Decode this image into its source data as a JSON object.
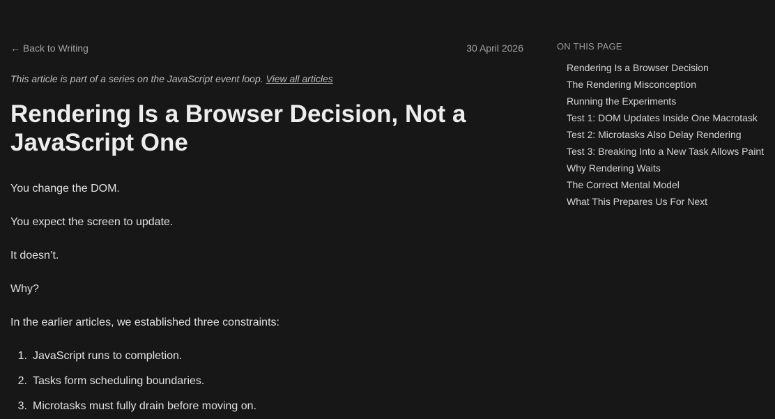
{
  "header": {
    "back_link": "← Back to Writing",
    "date": "30 April 2026"
  },
  "series_note": {
    "text": "This article is part of a series on the JavaScript event loop.",
    "link": "View all articles"
  },
  "article": {
    "title": "Rendering Is a Browser Decision, Not a JavaScript One",
    "paragraphs": [
      "You change the DOM.",
      "You expect the screen to update.",
      "It doesn’t.",
      "Why?",
      "In the earlier articles, we established three constraints:"
    ],
    "list": [
      {
        "num": "1.",
        "text": "JavaScript runs to completion."
      },
      {
        "num": "2.",
        "text": "Tasks form scheduling boundaries."
      },
      {
        "num": "3.",
        "text": "Microtasks must fully drain before moving on."
      }
    ]
  },
  "toc": {
    "heading": "ON THIS PAGE",
    "items": [
      "Rendering Is a Browser Decision",
      "The Rendering Misconception",
      "Running the Experiments",
      "Test 1: DOM Updates Inside One Macrotask",
      "Test 2: Microtasks Also Delay Rendering",
      "Test 3: Breaking Into a New Task Allows Paint",
      "Why Rendering Waits",
      "The Correct Mental Model",
      "What This Prepares Us For Next"
    ]
  }
}
